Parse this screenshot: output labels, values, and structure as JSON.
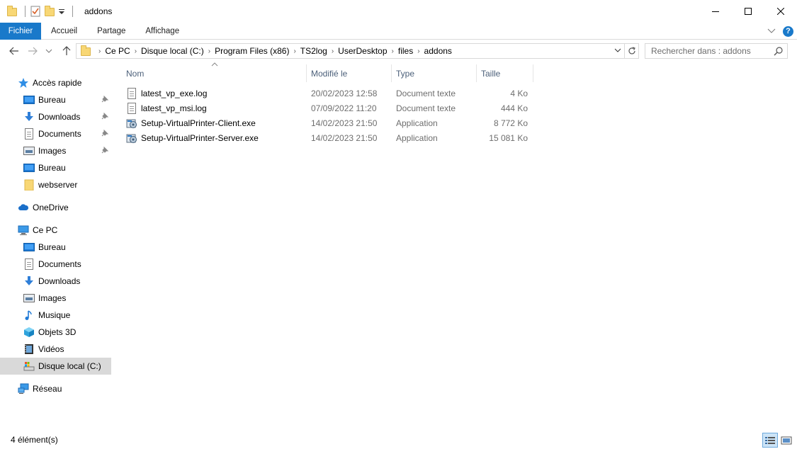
{
  "window": {
    "title": "addons",
    "minimize": "—",
    "maximize": "☐",
    "close": "✕"
  },
  "ribbon": {
    "tabs": [
      "Fichier",
      "Accueil",
      "Partage",
      "Affichage"
    ],
    "help": "?"
  },
  "address": {
    "breadcrumbs": [
      "Ce PC",
      "Disque local (C:)",
      "Program Files (x86)",
      "TS2log",
      "UserDesktop",
      "files",
      "addons"
    ],
    "search_placeholder": "Rechercher dans : addons"
  },
  "sidebar": {
    "items": [
      {
        "label": "Accès rapide",
        "icon": "star-icon"
      },
      {
        "label": "Bureau",
        "icon": "desktop-icon",
        "pinned": true
      },
      {
        "label": "Downloads",
        "icon": "download-icon",
        "pinned": true
      },
      {
        "label": "Documents",
        "icon": "documents-icon",
        "pinned": true
      },
      {
        "label": "Images",
        "icon": "images-icon",
        "pinned": true
      },
      {
        "label": "Bureau",
        "icon": "desktop-icon"
      },
      {
        "label": "webserver",
        "icon": "folder-icon"
      },
      {
        "label": "OneDrive",
        "icon": "cloud-icon"
      },
      {
        "label": "Ce PC",
        "icon": "computer-icon"
      },
      {
        "label": "Bureau",
        "icon": "desktop-icon"
      },
      {
        "label": "Documents",
        "icon": "documents-icon"
      },
      {
        "label": "Downloads",
        "icon": "download-icon"
      },
      {
        "label": "Images",
        "icon": "images-icon"
      },
      {
        "label": "Musique",
        "icon": "music-icon"
      },
      {
        "label": "Objets 3D",
        "icon": "cube-icon"
      },
      {
        "label": "Vidéos",
        "icon": "video-icon"
      },
      {
        "label": "Disque local (C:)",
        "icon": "drive-icon",
        "selected": true
      },
      {
        "label": "Réseau",
        "icon": "network-icon"
      }
    ]
  },
  "files": {
    "columns": [
      "Nom",
      "Modifié le",
      "Type",
      "Taille"
    ],
    "rows": [
      {
        "name": "latest_vp_exe.log",
        "modified": "20/02/2023 12:58",
        "type": "Document texte",
        "size": "4 Ko",
        "icon": "text-file-icon"
      },
      {
        "name": "latest_vp_msi.log",
        "modified": "07/09/2022 11:20",
        "type": "Document texte",
        "size": "444 Ko",
        "icon": "text-file-icon"
      },
      {
        "name": "Setup-VirtualPrinter-Client.exe",
        "modified": "14/02/2023 21:50",
        "type": "Application",
        "size": "8 772 Ko",
        "icon": "installer-icon"
      },
      {
        "name": "Setup-VirtualPrinter-Server.exe",
        "modified": "14/02/2023 21:50",
        "type": "Application",
        "size": "15 081 Ko",
        "icon": "installer-icon"
      }
    ]
  },
  "status": {
    "count": "4 élément(s)"
  },
  "colors": {
    "accent": "#1979ca",
    "selected": "#d9d9d9",
    "header_text": "#4c607a"
  }
}
